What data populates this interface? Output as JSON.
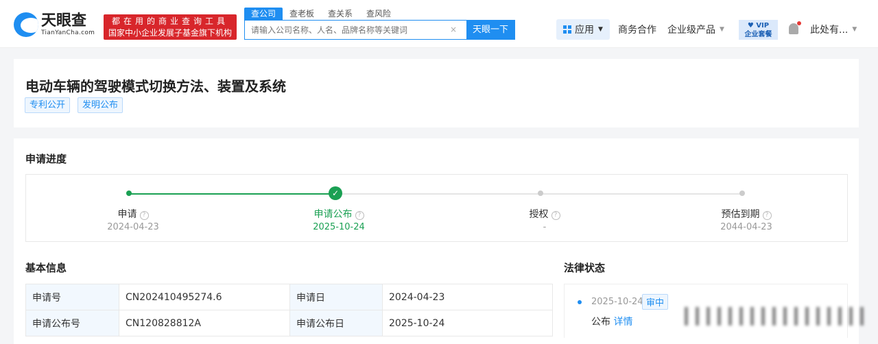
{
  "header": {
    "logo_main": "天眼查",
    "logo_sub": "TianYanCha.com",
    "slogan1": "都在用的商业查询工具",
    "slogan2": "国家中小企业发展子基金旗下机构",
    "search_tabs": [
      "查公司",
      "查老板",
      "查关系",
      "查风险"
    ],
    "search_placeholder": "请输入公司名称、人名、品牌名称等关键词",
    "clear": "×",
    "search_button": "天眼一下",
    "nav_app": "应用",
    "nav_business": "商务合作",
    "nav_enterprise": "企业级产品",
    "vip_top": "♥ VIP",
    "vip_bottom": "企业套餐",
    "user": "此处有..."
  },
  "patent": {
    "title": "电动车辆的驾驶模式切换方法、装置及系统",
    "tags": [
      "专利公开",
      "发明公布"
    ]
  },
  "progress": {
    "heading": "申请进度",
    "steps": [
      {
        "label": "申请",
        "date": "2024-04-23"
      },
      {
        "label": "申请公布",
        "date": "2025-10-24"
      },
      {
        "label": "授权",
        "date": "-"
      },
      {
        "label": "预估到期",
        "date": "2044-04-23"
      }
    ]
  },
  "basic": {
    "heading": "基本信息",
    "rows": [
      [
        "申请号",
        "CN202410495274.6",
        "申请日",
        "2024-04-23"
      ],
      [
        "申请公布号",
        "CN120828812A",
        "申请公布日",
        "2025-10-24"
      ]
    ]
  },
  "legal": {
    "heading": "法律状态",
    "date": "2025-10-24",
    "badge": "审中",
    "event": "公布",
    "detail": "详情"
  },
  "colors": {
    "accent": "#1f8ef1",
    "done": "#1aa053",
    "brand_red": "#d8262b"
  }
}
